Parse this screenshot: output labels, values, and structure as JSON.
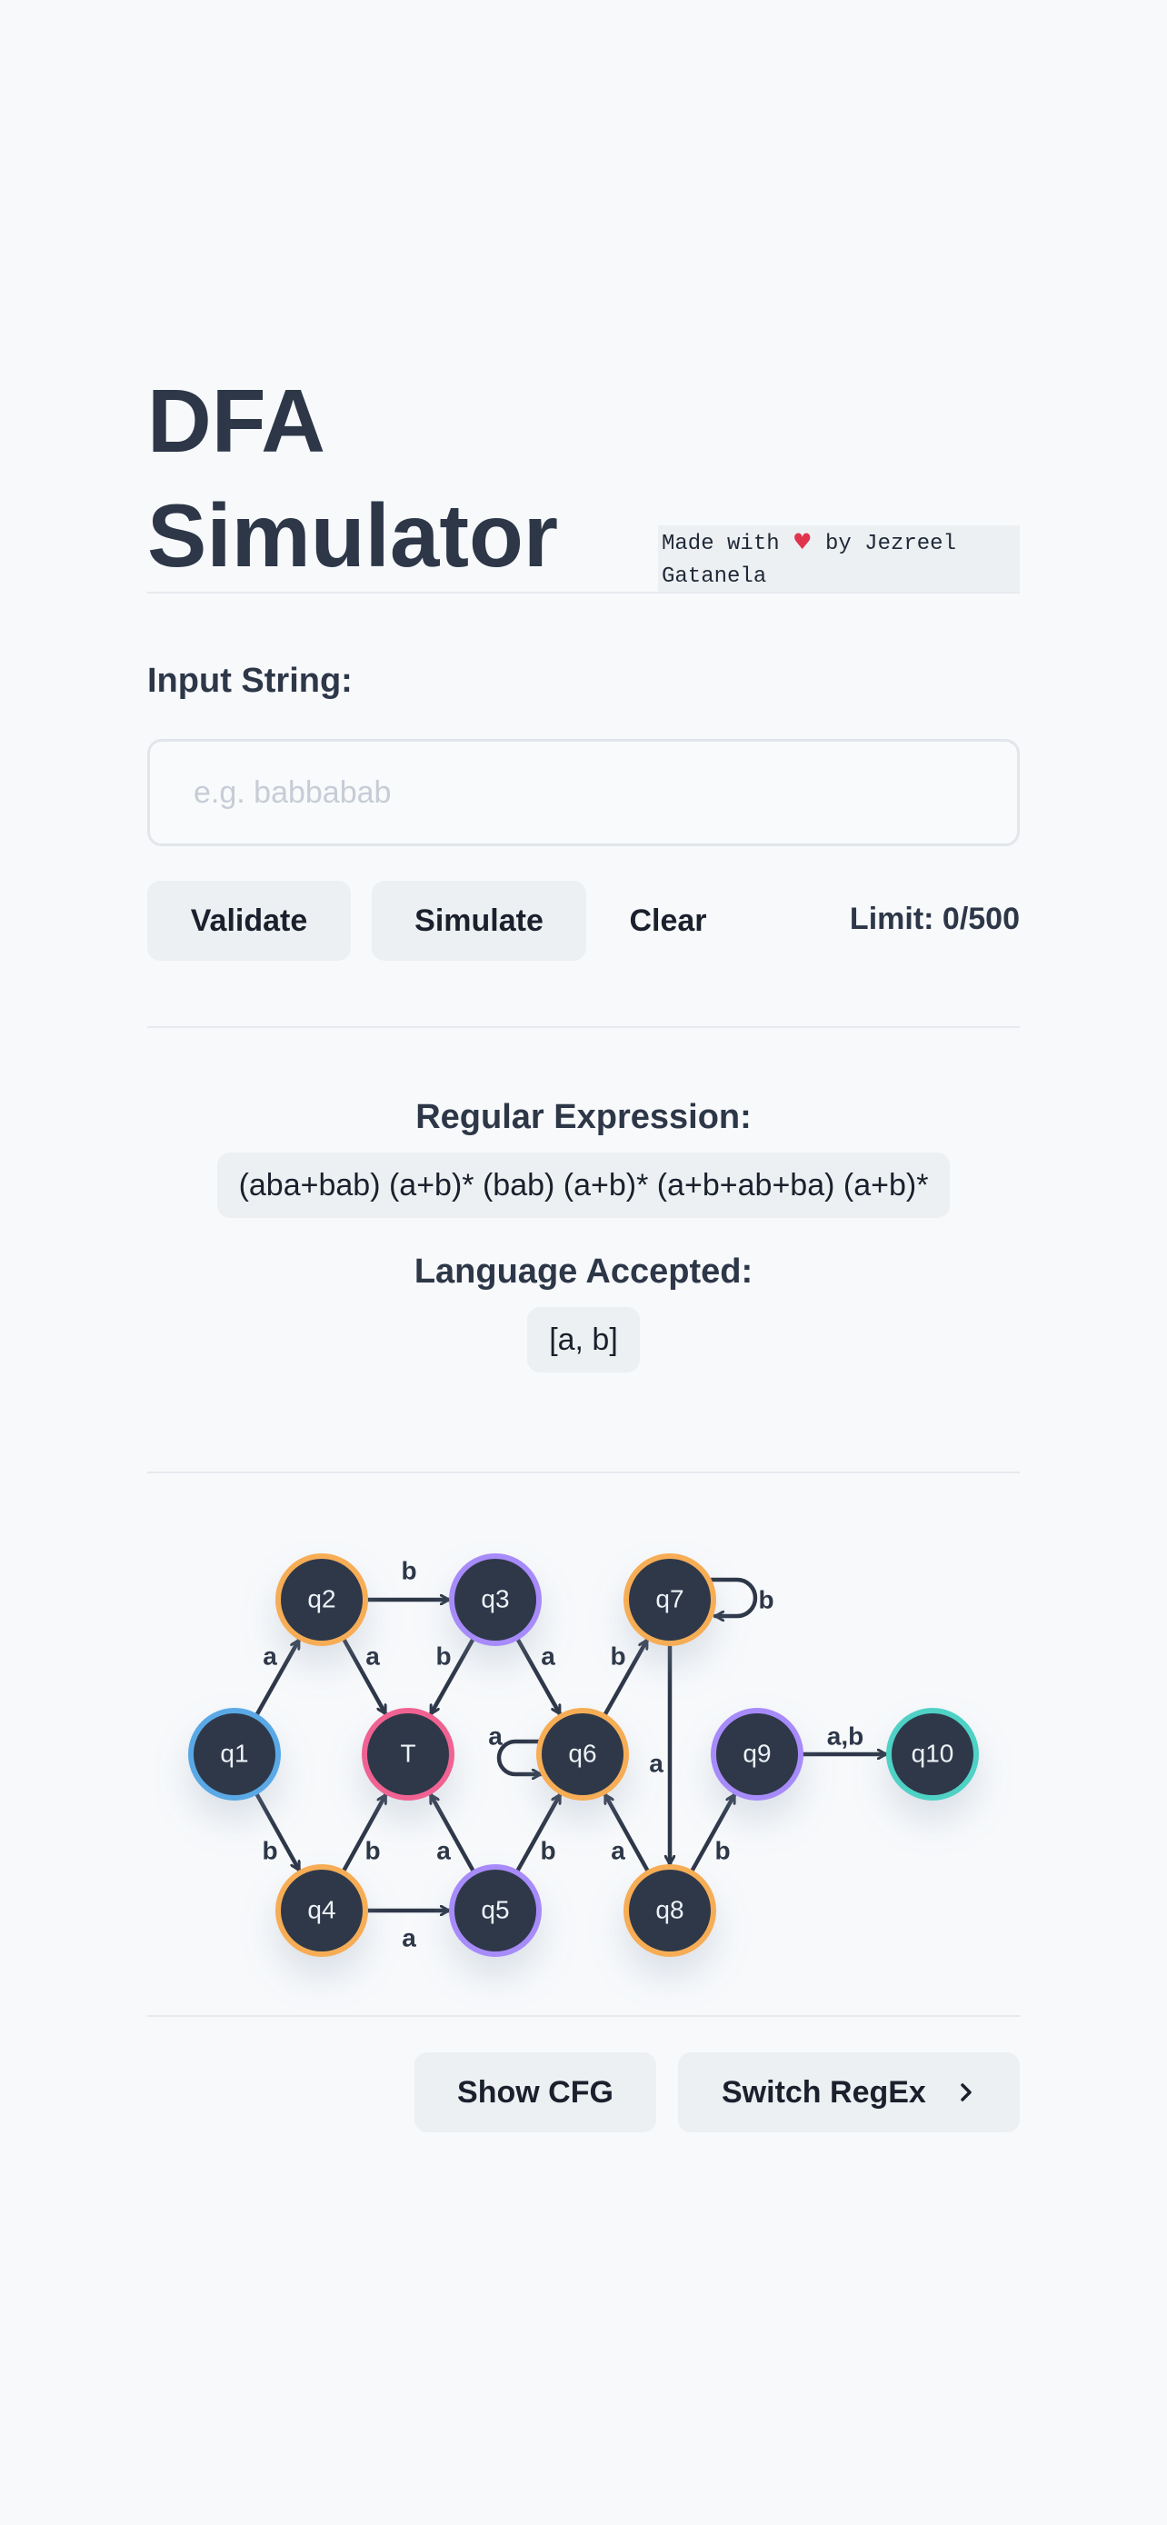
{
  "header": {
    "title_line1": "DFA",
    "title_line2": "Simulator",
    "credit_prefix": "Made with",
    "credit_heart": "♥",
    "credit_suffix": "by Jezreel Gatanela"
  },
  "input": {
    "label": "Input String:",
    "placeholder": "e.g. babbabab",
    "value": ""
  },
  "actions": {
    "validate_label": "Validate",
    "simulate_label": "Simulate",
    "clear_label": "Clear",
    "limit_text": "Limit: 0/500"
  },
  "regex": {
    "title": "Regular Expression:",
    "value": "(aba+bab) (a+b)* (bab) (a+b)* (a+b+ab+ba) (a+b)*"
  },
  "language": {
    "title": "Language Accepted:",
    "value": "[a, b]"
  },
  "dfa": {
    "colors": {
      "node_fill": "#2d3748",
      "arrow": "#2d3748",
      "start": "#5aa9e6",
      "orange": "#f6ad55",
      "purple": "#a78bfa",
      "trap": "#f06292",
      "final": "#4fd1c5"
    },
    "states": [
      {
        "id": "q1",
        "label": "q1",
        "ring": "start"
      },
      {
        "id": "q2",
        "label": "q2",
        "ring": "orange"
      },
      {
        "id": "q3",
        "label": "q3",
        "ring": "purple"
      },
      {
        "id": "T",
        "label": "T",
        "ring": "trap"
      },
      {
        "id": "q4",
        "label": "q4",
        "ring": "orange"
      },
      {
        "id": "q5",
        "label": "q5",
        "ring": "purple"
      },
      {
        "id": "q6",
        "label": "q6",
        "ring": "orange"
      },
      {
        "id": "q7",
        "label": "q7",
        "ring": "orange"
      },
      {
        "id": "q8",
        "label": "q8",
        "ring": "orange"
      },
      {
        "id": "q9",
        "label": "q9",
        "ring": "purple"
      },
      {
        "id": "q10",
        "label": "q10",
        "ring": "final"
      }
    ],
    "transitions": [
      {
        "from": "q1",
        "to": "q2",
        "label": "a"
      },
      {
        "from": "q1",
        "to": "q4",
        "label": "b"
      },
      {
        "from": "q2",
        "to": "q3",
        "label": "b"
      },
      {
        "from": "q2",
        "to": "T",
        "label": "a"
      },
      {
        "from": "q3",
        "to": "T",
        "label": "b"
      },
      {
        "from": "q3",
        "to": "q6",
        "label": "a"
      },
      {
        "from": "q4",
        "to": "T",
        "label": "b"
      },
      {
        "from": "q4",
        "to": "q5",
        "label": "a"
      },
      {
        "from": "q5",
        "to": "T",
        "label": "a"
      },
      {
        "from": "q5",
        "to": "q6",
        "label": "b"
      },
      {
        "from": "q6",
        "to": "q6",
        "label": "a"
      },
      {
        "from": "q6",
        "to": "q7",
        "label": "b"
      },
      {
        "from": "q7",
        "to": "q7",
        "label": "b"
      },
      {
        "from": "q7",
        "to": "q8",
        "label": "a"
      },
      {
        "from": "q8",
        "to": "q6",
        "label": "a"
      },
      {
        "from": "q8",
        "to": "q9",
        "label": "b"
      },
      {
        "from": "q9",
        "to": "q10",
        "label": "a,b"
      }
    ]
  },
  "footer": {
    "show_cfg_label": "Show CFG",
    "switch_regex_label": "Switch RegEx",
    "switch_icon": "chevron-right-icon"
  }
}
